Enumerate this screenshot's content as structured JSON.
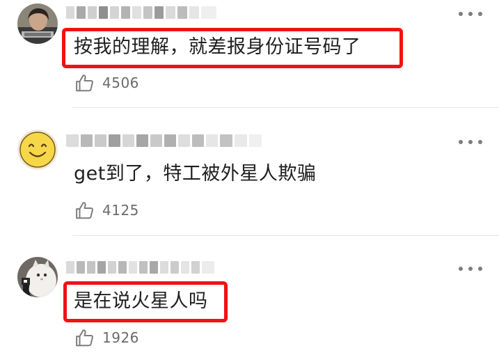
{
  "comments": [
    {
      "text": "按我的理解，就差报身份证号码了",
      "likes": "4506",
      "avatar_icon": "person-photo-avatar",
      "highlighted": true
    },
    {
      "text": "get到了，特工被外星人欺骗",
      "likes": "4125",
      "avatar_icon": "smiley-face-avatar",
      "highlighted": false
    },
    {
      "text": "是在说火星人吗",
      "likes": "1926",
      "avatar_icon": "cat-photo-avatar",
      "highlighted": true
    }
  ],
  "colors": {
    "highlight": "#f01212",
    "text": "#1e1e1e",
    "like_count": "#6a6a6a",
    "divider": "#e6e6e6",
    "icon": "#7d7d7d"
  },
  "icons": {
    "more": "more-dots-icon",
    "like": "thumbs-up-icon"
  }
}
